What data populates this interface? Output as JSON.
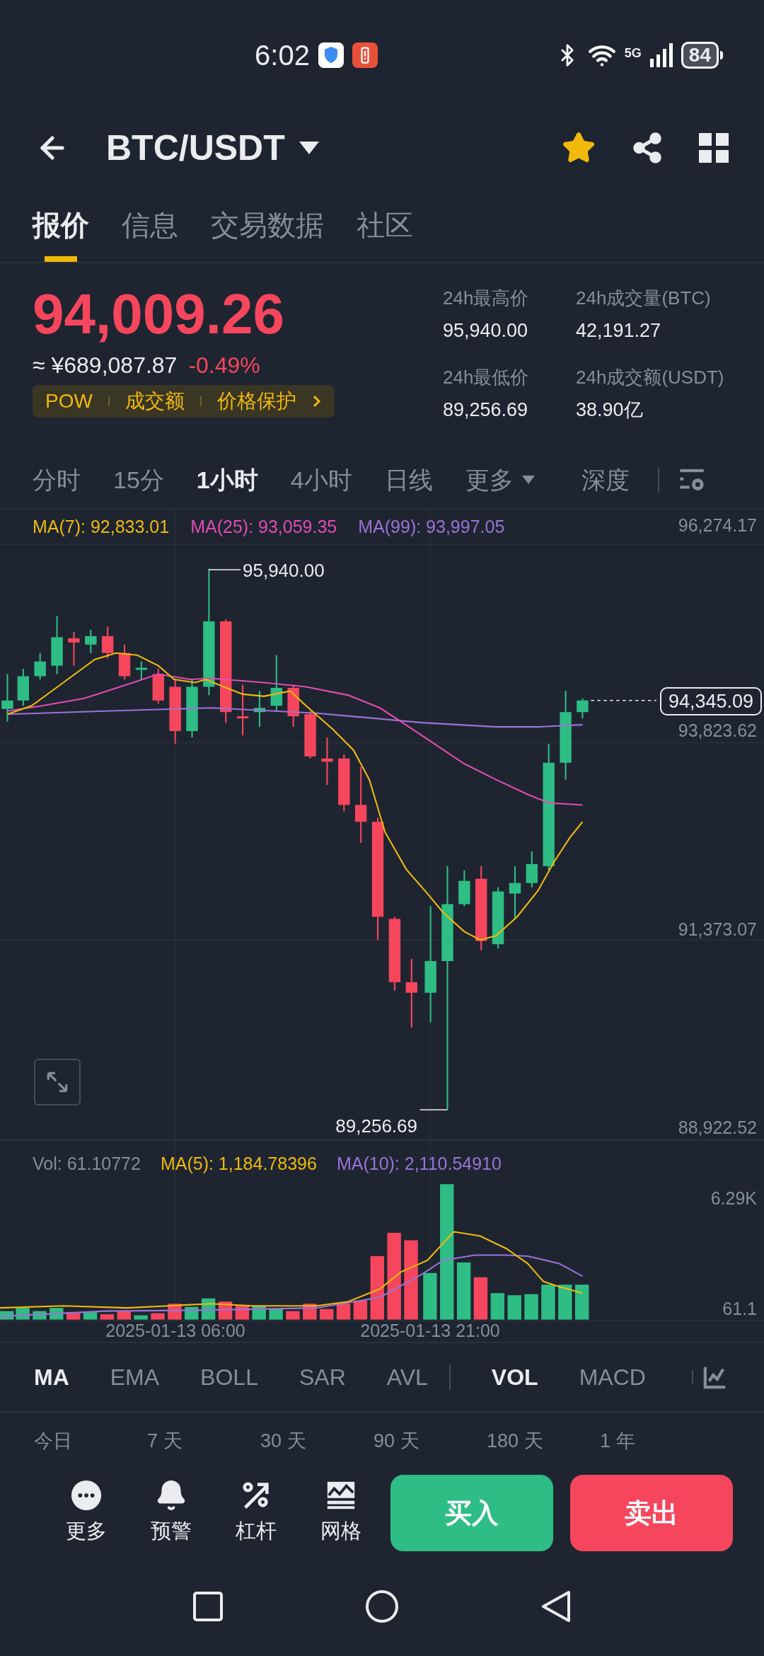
{
  "status_bar": {
    "time": "6:02",
    "network": "5G",
    "battery": "84"
  },
  "header": {
    "pair": "BTC/USDT",
    "favorite": true
  },
  "tabs": [
    {
      "label": "报价",
      "selected": true
    },
    {
      "label": "信息",
      "selected": false
    },
    {
      "label": "交易数据",
      "selected": false
    },
    {
      "label": "社区",
      "selected": false
    }
  ],
  "price": {
    "last": "94,009.26",
    "fiat": "≈ ¥689,087.87",
    "change": "-0.49%",
    "tags": [
      "POW",
      "成交额",
      "价格保护"
    ]
  },
  "stats": [
    {
      "label": "24h最高价",
      "value": "95,940.00"
    },
    {
      "label": "24h成交量(BTC)",
      "value": "42,191.27"
    },
    {
      "label": "24h最低价",
      "value": "89,256.69"
    },
    {
      "label": "24h成交额(USDT)",
      "value": "38.90亿"
    }
  ],
  "intervals": [
    {
      "label": "分时",
      "kind": "option",
      "selected": false
    },
    {
      "label": "15分",
      "kind": "option",
      "selected": false
    },
    {
      "label": "1小时",
      "kind": "option",
      "selected": true
    },
    {
      "label": "4小时",
      "kind": "option",
      "selected": false
    },
    {
      "label": "日线",
      "kind": "option",
      "selected": false
    },
    {
      "label": "更多",
      "kind": "dropdown",
      "selected": false
    },
    {
      "label": "深度",
      "kind": "option",
      "selected": false
    }
  ],
  "chart": {
    "ma_legend": [
      {
        "label": "MA(7): 92,833.01",
        "color": "#f0b90b"
      },
      {
        "label": "MA(25): 93,059.35",
        "color": "#e24bb4"
      },
      {
        "label": "MA(99): 93,997.05",
        "color": "#9c72d8"
      }
    ],
    "price_ticks": [
      "96,274.17",
      "93,823.62",
      "91,373.07",
      "88,922.52"
    ],
    "high_marker": "95,940.00",
    "low_marker": "89,256.69",
    "last_price": "94,345.09"
  },
  "volume": {
    "legend": [
      {
        "label": "Vol: 61.10772",
        "color": "#848e9c"
      },
      {
        "label": "MA(5): 1,184.78396",
        "color": "#f0b90b"
      },
      {
        "label": "MA(10): 2,110.54910",
        "color": "#9c72d8"
      }
    ],
    "ticks": [
      "6.29K",
      "61.1"
    ],
    "time_labels": [
      "2025-01-13 06:00",
      "2025-01-13 21:00"
    ]
  },
  "indicators": {
    "main": [
      {
        "label": "MA",
        "selected": true
      },
      {
        "label": "EMA",
        "selected": false
      },
      {
        "label": "BOLL",
        "selected": false
      },
      {
        "label": "SAR",
        "selected": false
      },
      {
        "label": "AVL",
        "selected": false
      }
    ],
    "sub": [
      {
        "label": "VOL",
        "selected": true
      },
      {
        "label": "MACD",
        "selected": false
      }
    ]
  },
  "periods": [
    "今日",
    "7 天",
    "30 天",
    "90 天",
    "180 天",
    "1 年"
  ],
  "actions": [
    {
      "label": "更多",
      "kind": "more"
    },
    {
      "label": "预警",
      "kind": "alert"
    },
    {
      "label": "杠杆",
      "kind": "leverage"
    },
    {
      "label": "网格",
      "kind": "grid"
    }
  ],
  "trade_buttons": [
    {
      "label": "买入",
      "kind": "buy"
    },
    {
      "label": "卖出",
      "kind": "sell"
    }
  ]
}
